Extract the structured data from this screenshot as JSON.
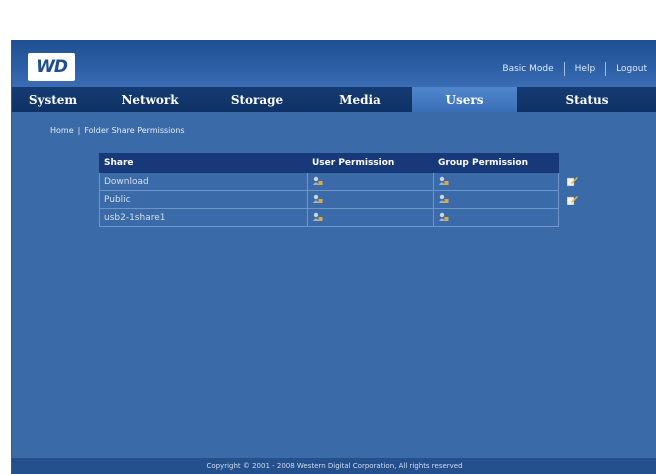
{
  "logo_text": "WD",
  "toplinks": {
    "basic_mode": "Basic Mode",
    "help": "Help",
    "logout": "Logout"
  },
  "nav": {
    "tabs": [
      {
        "label": "System"
      },
      {
        "label": "Network"
      },
      {
        "label": "Storage"
      },
      {
        "label": "Media"
      },
      {
        "label": "Users",
        "active": true
      },
      {
        "label": "Status"
      }
    ]
  },
  "breadcrumb": {
    "home": "Home",
    "separator": "|",
    "current": "Folder Share Permissions"
  },
  "table": {
    "headers": [
      "Share",
      "User Permission",
      "Group Permission"
    ],
    "rows": [
      {
        "share": "Download",
        "editable": true
      },
      {
        "share": "Public",
        "editable": true
      },
      {
        "share": "usb2-1share1",
        "editable": false
      }
    ]
  },
  "icons": {
    "permission": "permission-icon",
    "edit": "edit-icon"
  },
  "footer": "Copyright © 2001 - 2008 Western Digital Corporation, All rights reserved",
  "colors": {
    "background": "#3a6aa7",
    "navbar": "#0f3266",
    "active_tab": "#4f86cc",
    "table_header": "#17397a"
  }
}
